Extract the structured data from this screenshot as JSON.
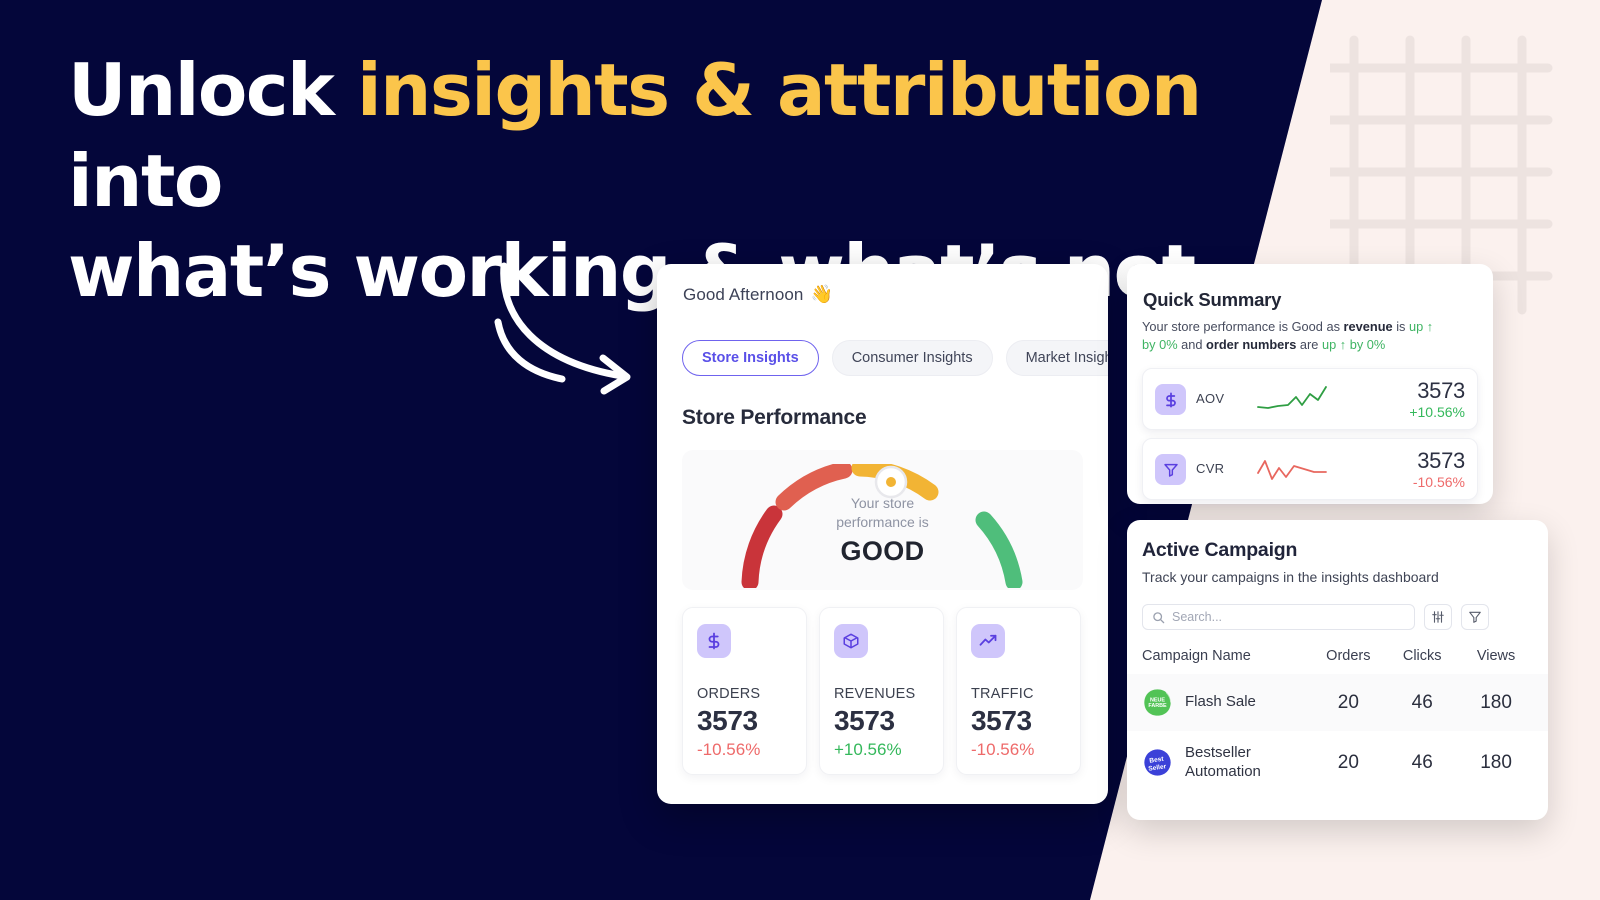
{
  "headline": {
    "line1_a": "Unlock ",
    "line1_hl": "insights & attribution",
    "line1_b": " into",
    "line2": "what’s working & what’s not"
  },
  "colors": {
    "navy": "#04063A",
    "cream": "#FBF1EE",
    "accent_yellow": "#FBC54B",
    "purple": "#5A3FE0",
    "green": "#34B85B",
    "red": "#EE6A6A"
  },
  "dashboard": {
    "greeting": "Good Afternoon",
    "greeting_emoji": "👋",
    "tabs": [
      {
        "label": "Store Insights",
        "active": true
      },
      {
        "label": "Consumer Insights",
        "active": false
      },
      {
        "label": "Market Insights",
        "active": false
      }
    ],
    "section_title": "Store Performance",
    "gauge": {
      "caption_line1": "Your store",
      "caption_line2": "performance is",
      "value": "GOOD",
      "segments": [
        {
          "name": "poor",
          "color": "#C9343A"
        },
        {
          "name": "fair",
          "color": "#E06050"
        },
        {
          "name": "good",
          "color": "#F2B434"
        },
        {
          "name": "great",
          "color": "#4FBE7B"
        }
      ],
      "needle_segment": "good"
    },
    "metrics": [
      {
        "icon": "dollar-icon",
        "label": "ORDERS",
        "value": "3573",
        "delta": "-10.56%",
        "direction": "down"
      },
      {
        "icon": "box-icon",
        "label": "REVENUES",
        "value": "3573",
        "delta": "+10.56%",
        "direction": "up"
      },
      {
        "icon": "trending-up-icon",
        "label": "TRAFFIC",
        "value": "3573",
        "delta": "-10.56%",
        "direction": "down"
      }
    ]
  },
  "quick_summary": {
    "title": "Quick Summary",
    "sentence": {
      "p1": "Your store performance is Good as ",
      "b1": "revenue",
      "p2": " is ",
      "g1": "up ↑ by 0%",
      "p3": " and ",
      "b2": "order numbers",
      "p4": " are ",
      "g2": "up ↑ by 0%"
    },
    "rows": [
      {
        "icon": "dollar-icon",
        "name": "AOV",
        "value": "3573",
        "delta": "+10.56%",
        "direction": "up",
        "spark": "up"
      },
      {
        "icon": "funnel-icon",
        "name": "CVR",
        "value": "3573",
        "delta": "-10.56%",
        "direction": "down",
        "spark": "down"
      }
    ]
  },
  "active_campaign": {
    "title": "Active Campaign",
    "subtitle": "Track your campaigns in the insights dashboard",
    "search_placeholder": "Search...",
    "toolbar_icons": [
      "sliders-icon",
      "filter-icon"
    ],
    "columns": [
      "Campaign Name",
      "Orders",
      "Clicks",
      "Views"
    ],
    "rows": [
      {
        "badge": "neue-farbe-badge",
        "badge_color": "#52C356",
        "badge_text": "NEUE FARBE",
        "name": "Flash Sale",
        "orders": "20",
        "clicks": "46",
        "views": "180"
      },
      {
        "badge": "best-seller-badge",
        "badge_color": "#3B41D8",
        "badge_text": "Best Seller",
        "name": "Bestseller Automation",
        "orders": "20",
        "clicks": "46",
        "views": "180"
      }
    ]
  }
}
